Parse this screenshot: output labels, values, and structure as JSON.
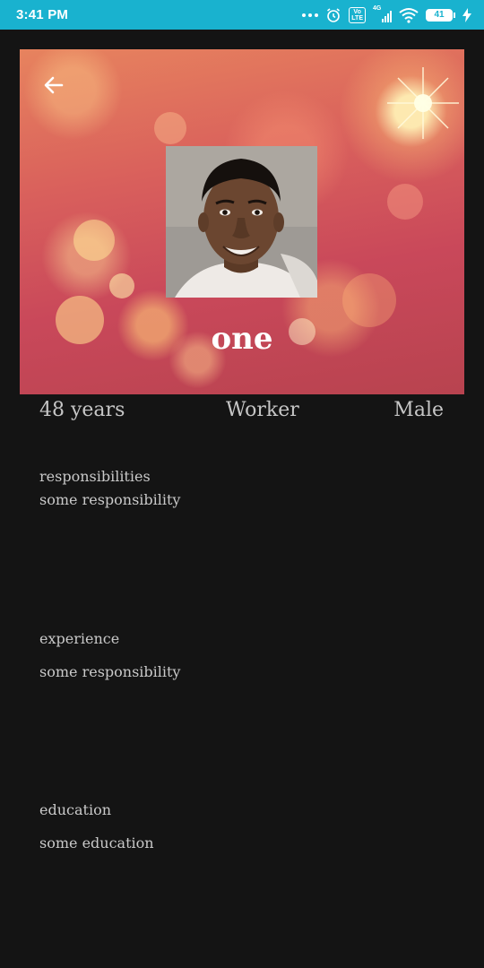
{
  "status_bar": {
    "time": "3:41 PM",
    "network": "4G",
    "volte": "Vo LTE",
    "battery": "41",
    "icons": [
      "more-dots-icon",
      "alarm-icon",
      "volte-icon",
      "signal-icon",
      "wifi-icon",
      "battery-icon",
      "charging-icon"
    ]
  },
  "header": {
    "back_icon": "arrow-left-icon",
    "name": "one"
  },
  "info": {
    "age": "48 years",
    "job": "Worker",
    "gender": "Male"
  },
  "sections": {
    "responsibilities_label": "responsibilities",
    "responsibilities_value": "some responsibility",
    "experience_label": "experience",
    "experience_value": "some responsibility",
    "education_label": "education",
    "education_value": "some education"
  },
  "colors": {
    "status_bar": "#19b2cf",
    "background": "#141414",
    "text": "#c6c6c6"
  }
}
